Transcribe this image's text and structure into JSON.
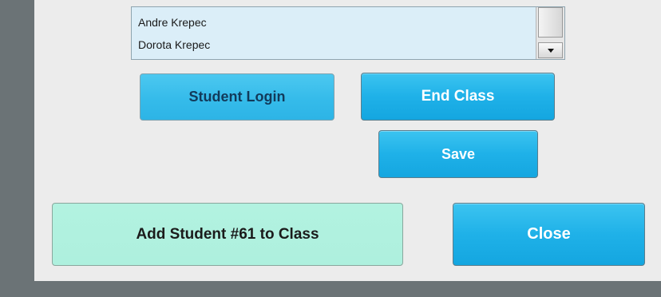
{
  "student_list": {
    "items": [
      {
        "name": "Andre Krepec"
      },
      {
        "name": "Dorota Krepec"
      }
    ]
  },
  "buttons": {
    "student_login": "Student Login",
    "end_class": "End Class",
    "save": "Save",
    "add_student": "Add Student #61 to Class",
    "close": "Close"
  },
  "colors": {
    "accent_blue": "#1fb1e8",
    "add_student_green": "#aef0de",
    "list_background": "#dbeef8",
    "panel_background": "#ececec",
    "frame_background": "#6b7376"
  },
  "icons": {
    "scroll_down": "chevron-down-icon"
  }
}
